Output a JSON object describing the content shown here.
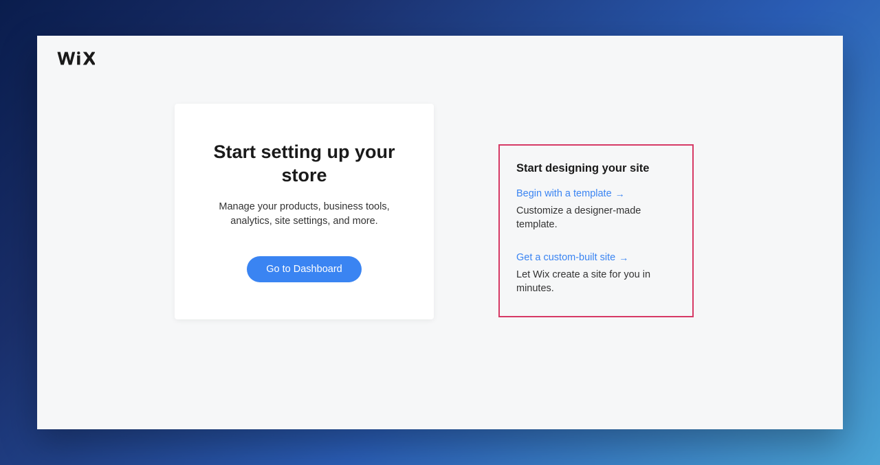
{
  "leftCard": {
    "title": "Start setting up your store",
    "description": "Manage your products, business tools, analytics, site settings, and more.",
    "buttonLabel": "Go to Dashboard"
  },
  "rightPanel": {
    "title": "Start designing your site",
    "options": [
      {
        "linkText": "Begin with a template",
        "arrow": "→",
        "description": "Customize a designer-made template."
      },
      {
        "linkText": "Get a custom-built site",
        "arrow": "→",
        "description": "Let Wix create a site for you in minutes."
      }
    ]
  }
}
